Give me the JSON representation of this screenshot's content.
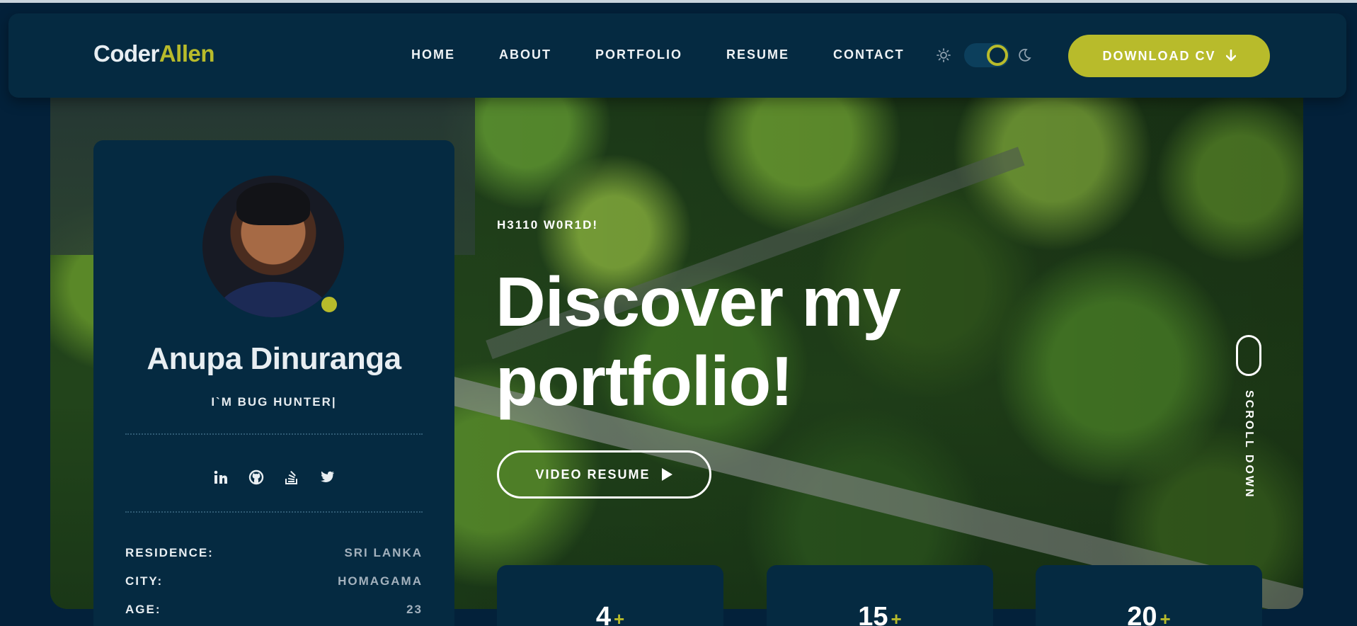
{
  "brand": {
    "part1": "Coder",
    "part2": "Allen"
  },
  "nav": {
    "items": [
      "HOME",
      "ABOUT",
      "PORTFOLIO",
      "RESUME",
      "CONTACT"
    ]
  },
  "header": {
    "download_label": "DOWNLOAD CV"
  },
  "hero": {
    "eyebrow": "H3110 W0R1D!",
    "headline_line1": "Discover my",
    "headline_line2": "portfolio!",
    "video_button": "VIDEO RESUME",
    "scroll_label": "SCROLL DOWN"
  },
  "profile": {
    "name": "Anupa Dinuranga",
    "role": "I`M BUG HUNTER|",
    "socials": [
      "linkedin-icon",
      "github-icon",
      "stackoverflow-icon",
      "twitter-icon"
    ],
    "info": [
      {
        "label": "RESIDENCE:",
        "value": "SRI LANKA"
      },
      {
        "label": "CITY:",
        "value": "HOMAGAMA"
      },
      {
        "label": "AGE:",
        "value": "23"
      }
    ]
  },
  "stats": [
    {
      "value": "4"
    },
    {
      "value": "15"
    },
    {
      "value": "20"
    }
  ],
  "colors": {
    "accent": "#b8bb2b",
    "panel": "#052a41",
    "background": "#03213a"
  }
}
